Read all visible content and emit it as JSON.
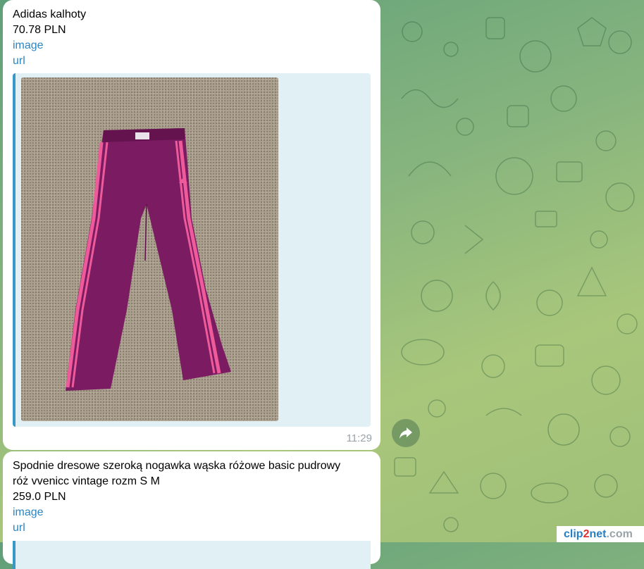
{
  "messages": [
    {
      "title": "Adidas kalhoty",
      "price": "70.78 PLN",
      "image_link": "image",
      "url_link": "url",
      "time": "11:29"
    },
    {
      "title_line1": "Spodnie dresowe szeroką nogawka wąska różowe basic pudrowy",
      "title_line2": "róż vvenicc vintage rozm S M",
      "price": "259.0 PLN",
      "image_link": "image",
      "url_link": "url"
    }
  ],
  "icons": {
    "share": "share-arrow-icon",
    "pattern": "doodle-pattern"
  },
  "watermark": {
    "part1": "clip",
    "part2": "2",
    "part3": "net",
    "part4": ".com"
  },
  "colors": {
    "link": "#2a86c4",
    "accent_bar": "#3a98c8",
    "preview_bg": "#e1f0f5",
    "pants": "#7b1c62",
    "stripe": "#ef5a9b"
  }
}
